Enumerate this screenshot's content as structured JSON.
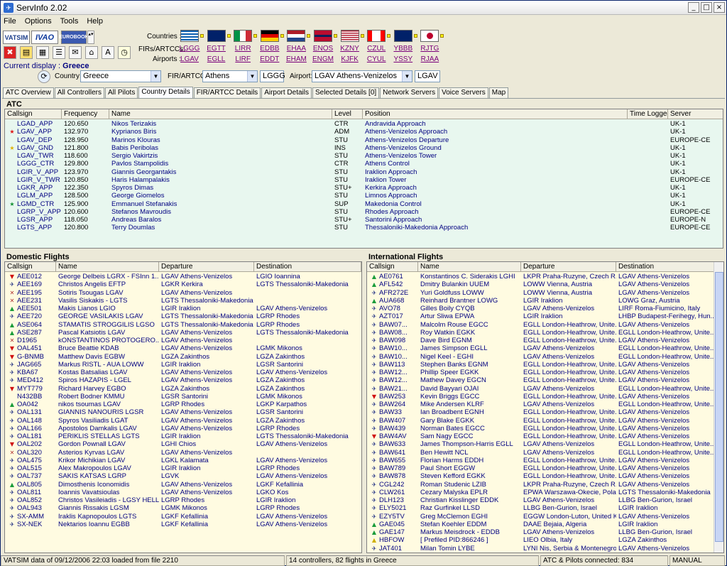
{
  "window": {
    "title": "ServInfo 2.02"
  },
  "menu": [
    "File",
    "Options",
    "Tools",
    "Help"
  ],
  "brands": {
    "vatsim": "VATSIM",
    "ivao": "IVAO",
    "eurobook": "EUROBOOK"
  },
  "labels": {
    "countries": "Countries :",
    "firs": "FIRs/ARTCCs:",
    "airports": "Airports :",
    "current_display": "Current display :",
    "current_country": "Greece",
    "country": "Country:",
    "fir": "FIR/ARTCC:",
    "airport": "Airport:"
  },
  "flags": [
    {
      "name": "greece-flag",
      "bg": "#0d5eaf",
      "fir": "LGGG",
      "apt": "LGAV"
    },
    {
      "name": "uk-flag",
      "bg": "#012169",
      "fir": "EGTT",
      "apt": "EGLL"
    },
    {
      "name": "italy-flag",
      "bg": "#009246",
      "fir": "LIRR",
      "apt": "LIRF"
    },
    {
      "name": "germany-flag",
      "bg": "#dd0000",
      "fir": "EDBB",
      "apt": "EDDT"
    },
    {
      "name": "netherlands-flag",
      "bg": "#ae1c28",
      "fir": "EHAA",
      "apt": "EHAM"
    },
    {
      "name": "norway-flag",
      "bg": "#ba0c2f",
      "fir": "ENOS",
      "apt": "ENGM"
    },
    {
      "name": "usa-flag",
      "bg": "#b22234",
      "fir": "KZNY",
      "apt": "KJFK"
    },
    {
      "name": "canada-flag",
      "bg": "#ff0000",
      "fir": "CZUL",
      "apt": "CYUL"
    },
    {
      "name": "australia-flag",
      "bg": "#012169",
      "fir": "YBBB",
      "apt": "YSSY"
    },
    {
      "name": "japan-flag",
      "bg": "#ffffff",
      "fir": "RJTG",
      "apt": "RJAA"
    }
  ],
  "selectors": {
    "country": "Greece",
    "fir": "Athens",
    "fir_code": "LGGG",
    "airport": "LGAV Athens-Venizelos",
    "airport_code": "LGAV"
  },
  "tabs": [
    "ATC Overview",
    "All Controllers",
    "All Pilots",
    "Country Details",
    "FIR/ARTCC Details",
    "Airport Details",
    "Selected Details [0]",
    "Network Servers",
    "Voice Servers",
    "Map"
  ],
  "active_tab": "Country Details",
  "atc": {
    "title": "ATC",
    "headers": [
      "Callsign",
      "Frequency",
      "Name",
      "Level",
      "Position",
      "Time Logged",
      "Server"
    ],
    "rows": [
      [
        "",
        "LGAD_APP",
        "120.650",
        "Nikos Terizakis",
        "CTR",
        "Andravida Approach",
        "",
        "UK-1"
      ],
      [
        "red",
        "LGAV_APP",
        "132.970",
        "Kyprianos Biris",
        "ADM",
        "Athens-Venizelos Approach",
        "",
        "UK-1"
      ],
      [
        "",
        "LGAV_DEP",
        "128.950",
        "Marinos Klouras",
        "STU",
        "Athens-Venizelos Departure",
        "",
        "EUROPE-CE"
      ],
      [
        "yellow",
        "LGAV_GND",
        "121.800",
        "Babis Peribolas",
        "INS",
        "Athens-Venizelos Ground",
        "",
        "UK-1"
      ],
      [
        "",
        "LGAV_TWR",
        "118.600",
        "Sergio Vakirtzis",
        "STU",
        "Athens-Venizelos Tower",
        "",
        "UK-1"
      ],
      [
        "",
        "LGGG_CTR",
        "129.800",
        "Pavlos Stampolidis",
        "CTR",
        "Athens Control",
        "",
        "UK-1"
      ],
      [
        "",
        "LGIR_V_APP",
        "123.970",
        "Giannis Georgantakis",
        "STU",
        "Iraklion Approach",
        "",
        "UK-1"
      ],
      [
        "",
        "LGIR_V_TWR",
        "120.850",
        "Haris Halampalakis",
        "STU",
        "Iraklion Tower",
        "",
        "EUROPE-CE"
      ],
      [
        "",
        "LGKR_APP",
        "122.350",
        "Spyros Dimas",
        "STU+",
        "Kerkira Approach",
        "",
        "UK-1"
      ],
      [
        "",
        "LGLM_APP",
        "128.500",
        "George Giomelos",
        "STU",
        "Limnos Approach",
        "",
        "UK-1"
      ],
      [
        "green",
        "LGMD_CTR",
        "125.900",
        "Emmanuel Stefanakis",
        "SUP",
        "Makedonia Control",
        "",
        "UK-1"
      ],
      [
        "",
        "LGRP_V_APP",
        "120.600",
        "Stefanos Mavroudis",
        "STU",
        "Rhodes Approach",
        "",
        "EUROPE-CE"
      ],
      [
        "",
        "LGSR_APP",
        "118.050",
        "Andreas Baralos",
        "STU+",
        "Santorini Approach",
        "",
        "EUROPE-N"
      ],
      [
        "",
        "LGTS_APP",
        "120.800",
        "Terry Doumlas",
        "STU",
        "Thessaloniki-Makedonia Approach",
        "",
        "EUROPE-CE"
      ]
    ]
  },
  "domestic": {
    "title": "Domestic Flights",
    "headers": [
      "Callsign",
      "Name",
      "Departure",
      "Destination"
    ],
    "rows": [
      [
        "down",
        "AEE012",
        "George Delbeis LGRX - FSInn 1...",
        "LGAV Athens-Venizelos",
        "LGIO Ioannina"
      ],
      [
        "plane",
        "AEE169",
        "Christos Angelis EFTP",
        "LGKR Kerkira",
        "LGTS Thessaloniki-Makedonia"
      ],
      [
        "x",
        "AEE195",
        "Sotiris Tsougas LGAV",
        "LGAV Athens-Venizelos",
        ""
      ],
      [
        "x",
        "AEE231",
        "Vasilis Siskakis - LGTS",
        "LGTS Thessaloniki-Makedonia",
        ""
      ],
      [
        "up",
        "AEE501",
        "Makis Lianos LGIO",
        "LGIR Iraklion",
        "LGAV Athens-Venizelos"
      ],
      [
        "plane",
        "AEE720",
        "GEORGE VASILAKIS LGAV",
        "LGTS Thessaloniki-Makedonia",
        "LGRP Rhodes"
      ],
      [
        "up",
        "ASE064",
        "STAMATIS STROGGILIS LGSO",
        "LGTS Thessaloniki-Makedonia",
        "LGRP Rhodes"
      ],
      [
        "up",
        "ASE287",
        "Pascal Katsiotis LGAV",
        "LGAV Athens-Venizelos",
        "LGTS Thessaloniki-Makedonia"
      ],
      [
        "x",
        "D1965",
        "kONSTANTINOS PROTOGERO...",
        "LGAV Athens-Venizelos",
        ""
      ],
      [
        "down",
        "OAL451",
        "Bruce Beattie KDAB",
        "LGAV Athens-Venizelos",
        "LGMK Mikonos"
      ],
      [
        "down",
        "G-BNMB",
        "Matthew Davis EGBW",
        "LGZA Zakinthos",
        "LGZA Zakinthos"
      ],
      [
        "plane",
        "JAG665",
        "Markus RISTL - AUA LOWW",
        "LGIR Iraklion",
        "LGSR Santorini"
      ],
      [
        "plane",
        "KBA67",
        "Kostas Batsalias LGAV",
        "LGAV Athens-Venizelos",
        "LGAV Athens-Venizelos"
      ],
      [
        "plane",
        "MED412",
        "Spiros HAZAPIS - LGEL",
        "LGAV Athens-Venizelos",
        "LGZA Zakinthos"
      ],
      [
        "down",
        "MYT779",
        "Richard Harvey EGBO",
        "LGZA Zakinthos",
        "LGZA Zakinthos"
      ],
      [
        "",
        "N432BB",
        "Robert Bodner KMMU",
        "LGSR Santorini",
        "LGMK Mikonos"
      ],
      [
        "up",
        "OA042",
        "nikos tsoumas LGAV",
        "LGRP Rhodes",
        "LGKP Karpathos"
      ],
      [
        "plane",
        "OAL131",
        "GIANNIS NANOURIS LGSR",
        "LGAV Athens-Venizelos",
        "LGSR Santorini"
      ],
      [
        "plane",
        "OAL148",
        "Spyros Vasiliadis LGAT",
        "LGAV Athens-Venizelos",
        "LGZA Zakinthos"
      ],
      [
        "plane",
        "OAL166",
        "Apostolos Damkalis LGAV",
        "LGAV Athens-Venizelos",
        "LGRP Rhodes"
      ],
      [
        "plane",
        "OAL181",
        "PERIKLIS STELLAS LGTS",
        "LGIR Iraklion",
        "LGTS Thessaloniki-Makedonia"
      ],
      [
        "down",
        "OAL202",
        "Gordon Pownall LGAV",
        "LGHI Chios",
        "LGAV Athens-Venizelos"
      ],
      [
        "x",
        "OAL320",
        "Asterios Kyrvas LGAV",
        "LGAV Athens-Venizelos",
        ""
      ],
      [
        "plane",
        "OAL475",
        "Krikor Michikian LGAV",
        "LGKL Kalamata",
        "LGAV Athens-Venizelos"
      ],
      [
        "plane",
        "OAL515",
        "Alex Makropoulos LGAV",
        "LGIR Iraklion",
        "LGRP Rhodes"
      ],
      [
        "plane",
        "OAL737",
        "SAKIS KATSAS LGRP",
        "LGVK",
        "LGAV Athens-Venizelos"
      ],
      [
        "up",
        "OAL805",
        "Dimosthenis Iconomidis",
        "LGAV Athens-Venizelos",
        "LGKF Kefallinia"
      ],
      [
        "plane",
        "OAL811",
        "Ioannis Vavatsioulas",
        "LGAV Athens-Venizelos",
        "LGKO Kos"
      ],
      [
        "plane",
        "OAL852",
        "Christos Vasileiadis - LGSY HELL...",
        "LGRP Rhodes",
        "LGIR Iraklion"
      ],
      [
        "plane",
        "OAL943",
        "Giannis Rissakis LGSM",
        "LGMK Mikonos",
        "LGRP Rhodes"
      ],
      [
        "plane",
        "SX-AMM",
        "Iraklis Kapnopoulos LGTS",
        "LGKF Kefallinia",
        "LGAV Athens-Venizelos"
      ],
      [
        "plane",
        "SX-NEK",
        "Nektarios Ioannu EGBB",
        "LGKF Kefallinia",
        "LGAV Athens-Venizelos"
      ]
    ]
  },
  "international": {
    "title": "International Flights",
    "headers": [
      "Callsign",
      "Name",
      "Departure",
      "Destination"
    ],
    "rows": [
      [
        "up",
        "AE0761",
        "Konstantinos C. Siderakis LGHI",
        "LKPR Praha-Ruzyne, Czech R...",
        "LGAV Athens-Venizelos"
      ],
      [
        "up",
        "AFL542",
        "Dmitry Bulankin UUEM",
        "LOWW Vienna, Austria",
        "LGAV Athens-Venizelos"
      ],
      [
        "plane",
        "AFR272E",
        "Yuri Goldfuss LOWW",
        "LOWW Vienna, Austria",
        "LGAV Athens-Venizelos"
      ],
      [
        "up",
        "AUA668",
        "Reinhard Brantner LOWG",
        "LGIR Iraklion",
        "LOWG Graz, Austria"
      ],
      [
        "plane",
        "AVO78",
        "Gilles Boily CYQB",
        "LGAV Athens-Venizelos",
        "LIRF Roma-Fiumicino, Italy"
      ],
      [
        "plane",
        "AZT017",
        "Artur Sliwa EPWA",
        "LGIR Iraklion",
        "LHBP Budapest-Ferihegy, Hun..."
      ],
      [
        "plane",
        "BAW07...",
        "Malcolm Rouse EGCC",
        "EGLL London-Heathrow, Unite...",
        "LGAV Athens-Venizelos"
      ],
      [
        "plane",
        "BAW08...",
        "Roy Watkin EGKK",
        "EGLL London-Heathrow, Unite...",
        "EGLL London-Heathrow, Unite..."
      ],
      [
        "plane",
        "BAW098",
        "Dave Bird EGNM",
        "EGLL London-Heathrow, Unite...",
        "LGAV Athens-Venizelos"
      ],
      [
        "plane",
        "BAW10...",
        "James Simpson EGLL",
        "LGAV Athens-Venizelos",
        "EGLL London-Heathrow, Unite..."
      ],
      [
        "plane",
        "BAW10...",
        "Nigel Keel - EGHI",
        "LGAV Athens-Venizelos",
        "EGLL London-Heathrow, Unite..."
      ],
      [
        "plane",
        "BAW113",
        "Stephen Banks EGNM",
        "EGLL London-Heathrow, Unite...",
        "LGAV Athens-Venizelos"
      ],
      [
        "plane",
        "BAW12...",
        "Phillip Speer EGKK",
        "EGLL London-Heathrow, Unite...",
        "LGAV Athens-Venizelos"
      ],
      [
        "plane",
        "BAW12...",
        "Mathew Davey EGCN",
        "EGLL London-Heathrow, Unite...",
        "LGAV Athens-Venizelos"
      ],
      [
        "plane",
        "BAW21...",
        "David Bayyari OJAI",
        "LGAV Athens-Venizelos",
        "EGLL London-Heathrow, Unite..."
      ],
      [
        "down",
        "BAW253",
        "Kevin Briggs EGCC",
        "EGLL London-Heathrow, Unite...",
        "LGAV Athens-Venizelos"
      ],
      [
        "plane",
        "BAW264",
        "Mike Andersen KLRF",
        "LGAV Athens-Venizelos",
        "EGLL London-Heathrow, Unite..."
      ],
      [
        "plane",
        "BAW33",
        "Ian Broadbent EGNH",
        "EGLL London-Heathrow, Unite...",
        "LGAV Athens-Venizelos"
      ],
      [
        "plane",
        "BAW407",
        "Gary Blake EGKK",
        "EGLL London-Heathrow, Unite...",
        "LGAV Athens-Venizelos"
      ],
      [
        "plane",
        "BAW439",
        "Norman Bates EGCC",
        "EGLL London-Heathrow, Unite...",
        "LGAV Athens-Venizelos"
      ],
      [
        "down",
        "BAW4AV",
        "Sam Nagy EGCC",
        "EGLL London-Heathrow, Unite...",
        "LGAV Athens-Venizelos"
      ],
      [
        "plane",
        "BAW633",
        "James Thompson-Harris EGLL",
        "LGAV Athens-Venizelos",
        "EGLL London-Heathrow, Unite..."
      ],
      [
        "plane",
        "BAW641",
        "Ben Hewitt NCL",
        "LGAV Athens-Venizelos",
        "EGLL London-Heathrow, Unite..."
      ],
      [
        "plane",
        "BAW655",
        "Florian Harms EDDH",
        "EGLL London-Heathrow, Unite...",
        "LGAV Athens-Venizelos"
      ],
      [
        "plane",
        "BAW789",
        "Paul Short EGGW",
        "EGLL London-Heathrow, Unite...",
        "LGAV Athens-Venizelos"
      ],
      [
        "plane",
        "BAW878",
        "Steven Kefford EGKK",
        "EGLL London-Heathrow, Unite...",
        "LGAV Athens-Venizelos"
      ],
      [
        "plane",
        "CGL242",
        "Roman Studenic LZIB",
        "LKPR Praha-Ruzyne, Czech R...",
        "LGAV Athens-Venizelos"
      ],
      [
        "plane",
        "CLW261",
        "Cezary Malyska EPLR",
        "EPWA Warszawa-Okecie, Pola...",
        "LGTS Thessaloniki-Makedonia"
      ],
      [
        "plane",
        "DLH123",
        "Christian Kisslinger EDDK",
        "LGAV Athens-Venizelos",
        "LLBG Ben-Gurion, Israel"
      ],
      [
        "plane",
        "ELY5021",
        "Raz Gurfinkel LLSD",
        "LLBG Ben-Gurion, Israel",
        "LGIR Iraklion"
      ],
      [
        "plane",
        "EZY5TV",
        "Greg McClemon EGHI",
        "EGGW London-Luton, United K...",
        "LGAV Athens-Venizelos"
      ],
      [
        "up",
        "GAE045",
        "Stefan Koehler EDDM",
        "DAAE Bejaia, Algeria",
        "LGIR Iraklion"
      ],
      [
        "up",
        "GAE147",
        "Markus Meisdrock - EDDB",
        "LGAV Athens-Venizelos",
        "LLBG Ben-Gurion, Israel"
      ],
      [
        "up-yellow",
        "HBFOW",
        "[ Prefiled PID:866246 ]",
        "LIEO Olbia, Italy",
        "LGZA Zakinthos"
      ],
      [
        "plane",
        "JAT401",
        "Milan Tomin LYBE",
        "LYNI Nis, Serbia & Montenegro",
        "LGAV Athens-Venizelos"
      ]
    ]
  },
  "status": {
    "left": "VATSIM data of 09/12/2006 22:03 loaded from file 2210",
    "middle": "14 controllers, 82 flights in Greece",
    "right": "ATC & Pilots connected: 834",
    "mode": "MANUAL"
  }
}
